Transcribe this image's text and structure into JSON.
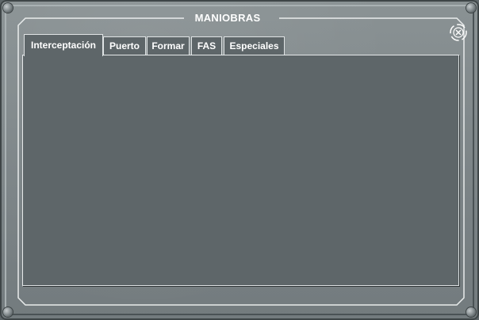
{
  "window": {
    "title": "MANIOBRAS"
  },
  "close_button": {
    "icon": "close-icon"
  },
  "tabs": [
    {
      "label": "Interceptación",
      "active": true
    },
    {
      "label": "Puerto",
      "active": false
    },
    {
      "label": "Formar",
      "active": false
    },
    {
      "label": "FAS",
      "active": false
    },
    {
      "label": "Especiales",
      "active": false
    }
  ],
  "colors": {
    "frame": "#7d8588",
    "panel": "#5e6669",
    "text": "#ffffff",
    "border_light": "#dfe3e4"
  }
}
